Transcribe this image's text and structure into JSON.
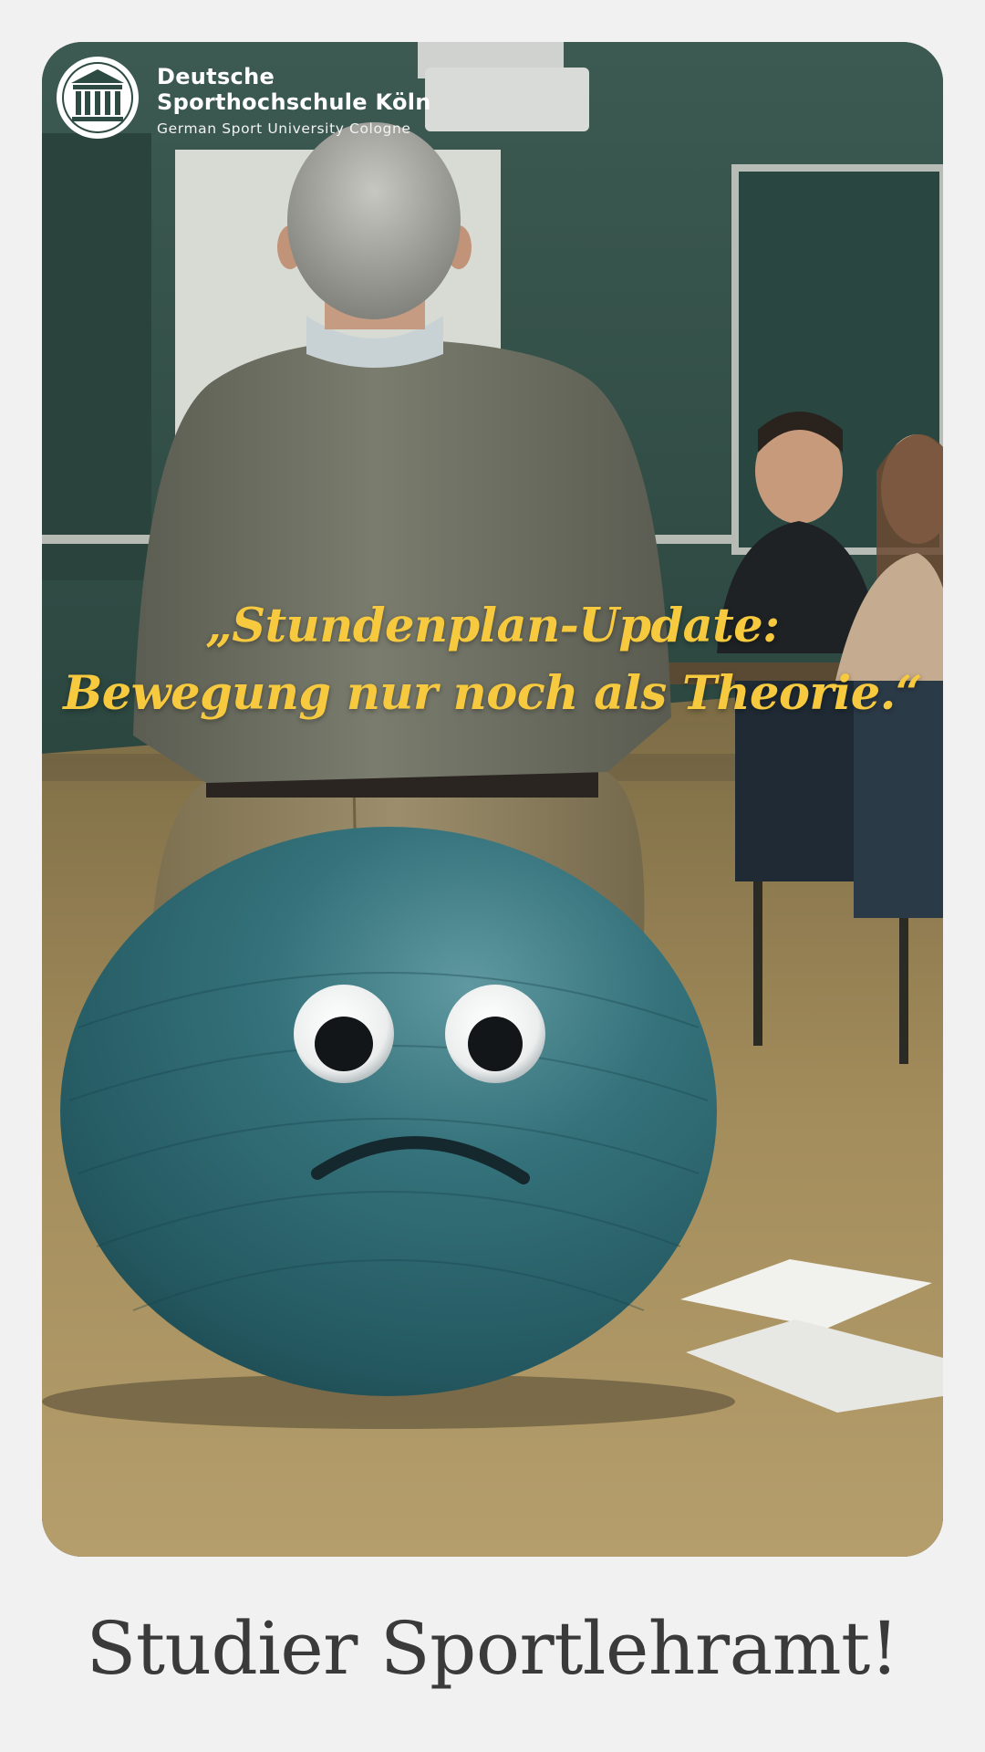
{
  "logo": {
    "icon": "university-building-icon",
    "line1": "Deutsche",
    "line2": "Sporthochschule Köln",
    "line3": "German Sport University Cologne"
  },
  "headline": {
    "line1": "„Stundenplan-Update:",
    "line2": "Bewegung nur noch als Theorie.“",
    "color": "#f6c93e"
  },
  "cta": {
    "text": "Studier Sportlehramt!"
  },
  "colors": {
    "background": "#f2f1f1",
    "ball": "#2f6d77",
    "cta_text": "#3a3a3a"
  }
}
